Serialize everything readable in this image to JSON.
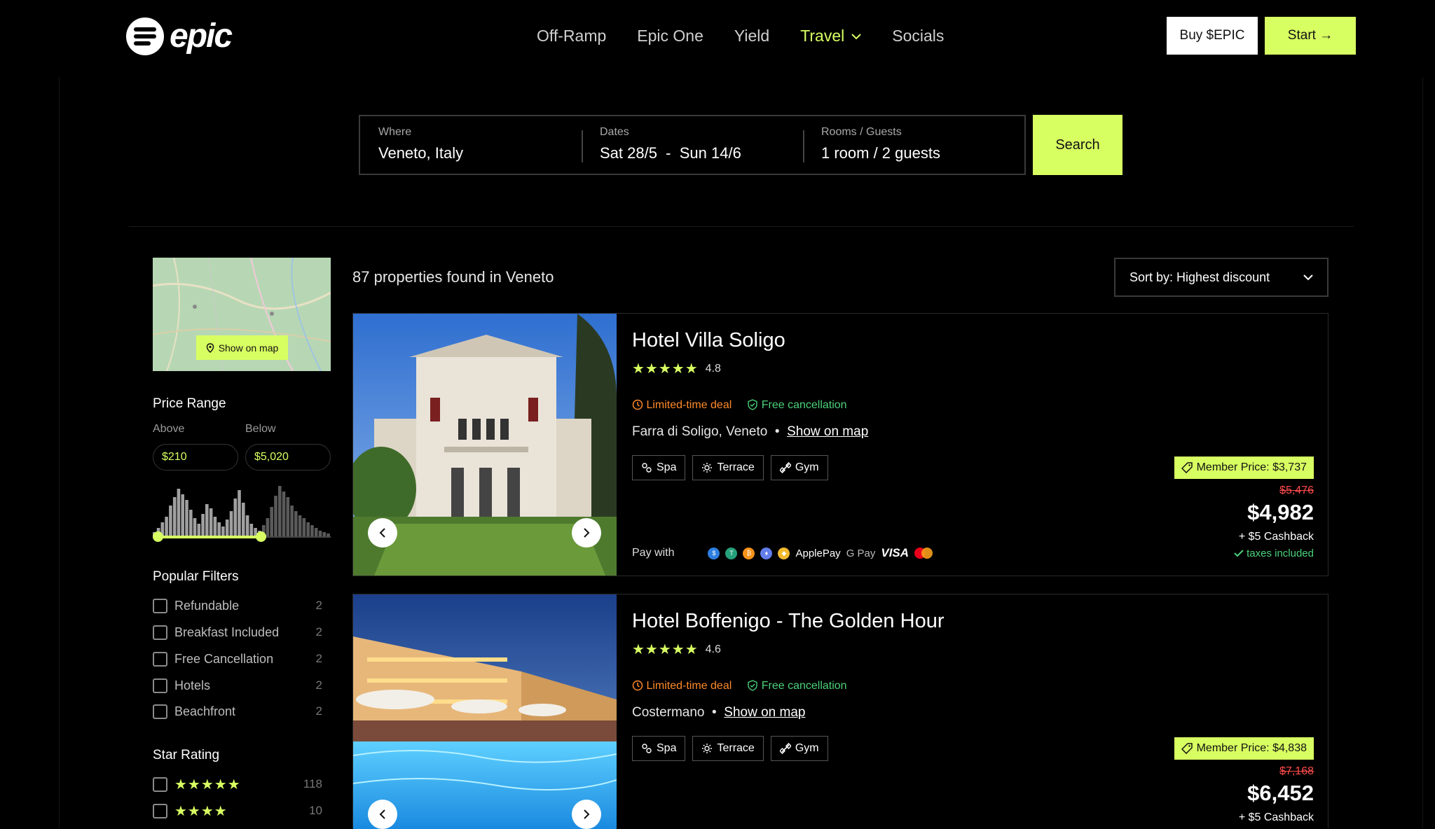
{
  "header": {
    "logo_text": "epic",
    "nav": [
      {
        "label": "Off-Ramp"
      },
      {
        "label": "Epic One"
      },
      {
        "label": "Yield"
      },
      {
        "label": "Travel"
      },
      {
        "label": "Socials"
      }
    ],
    "buy_label": "Buy $EPIC",
    "start_label": "Start →"
  },
  "search": {
    "where_label": "Where",
    "where_value": "Veneto, Italy",
    "dates_label": "Dates",
    "dates_value": "Sat 28/5  -  Sun 14/6",
    "guests_label": "Rooms / Guests",
    "guests_value": "1 room / 2 guests",
    "button": "Search"
  },
  "sidebar": {
    "map_button": "Show on map",
    "price_title": "Price Range",
    "above_label": "Above",
    "below_label": "Below",
    "above_value": "$210",
    "below_value": "$5,020",
    "popular_title": "Popular Filters",
    "filters": [
      {
        "label": "Refundable",
        "count": "2"
      },
      {
        "label": "Breakfast Included",
        "count": "2"
      },
      {
        "label": "Free Cancellation",
        "count": "2"
      },
      {
        "label": "Hotels",
        "count": "2"
      },
      {
        "label": "Beachfront",
        "count": "2"
      }
    ],
    "star_title": "Star Rating",
    "star_rows": [
      {
        "stars": "★★★★★",
        "count": "118"
      },
      {
        "stars": "★★★★",
        "count": "10"
      }
    ]
  },
  "results": {
    "count_text": "87 properties found in Veneto",
    "sort_label": "Sort by: Highest discount"
  },
  "hotels": [
    {
      "name": "Hotel Villa Soligo",
      "stars": "★★★★★",
      "rating": "4.8",
      "deal": "Limited-time deal",
      "cancel": "Free cancellation",
      "location": "Farra di Soligo, Veneto",
      "map_link": "Show on map",
      "amenities": [
        "Spa",
        "Terrace",
        "Gym"
      ],
      "pay_label": "Pay with",
      "member_price": "Member Price: $3,737",
      "old_price": "$5,476",
      "price": "$4,982",
      "cashback": "+ $5 Cashback",
      "taxes": "taxes included"
    },
    {
      "name": "Hotel Boffenigo - The Golden Hour",
      "stars": "★★★★★",
      "rating": "4.6",
      "deal": "Limited-time deal",
      "cancel": "Free cancellation",
      "location": "Costermano",
      "map_link": "Show on map",
      "amenities": [
        "Spa",
        "Terrace",
        "Gym"
      ],
      "member_price": "Member Price: $4,838",
      "old_price": "$7,168",
      "price": "$6,452",
      "cashback": "+ $5 Cashback"
    }
  ],
  "payment_icons": [
    "ApplePay",
    "G Pay",
    "VISA"
  ],
  "colors": {
    "accent": "#d8ff62",
    "deal": "#ff8a2a",
    "free": "#4cd27a",
    "old_price": "#ff4b4b"
  }
}
